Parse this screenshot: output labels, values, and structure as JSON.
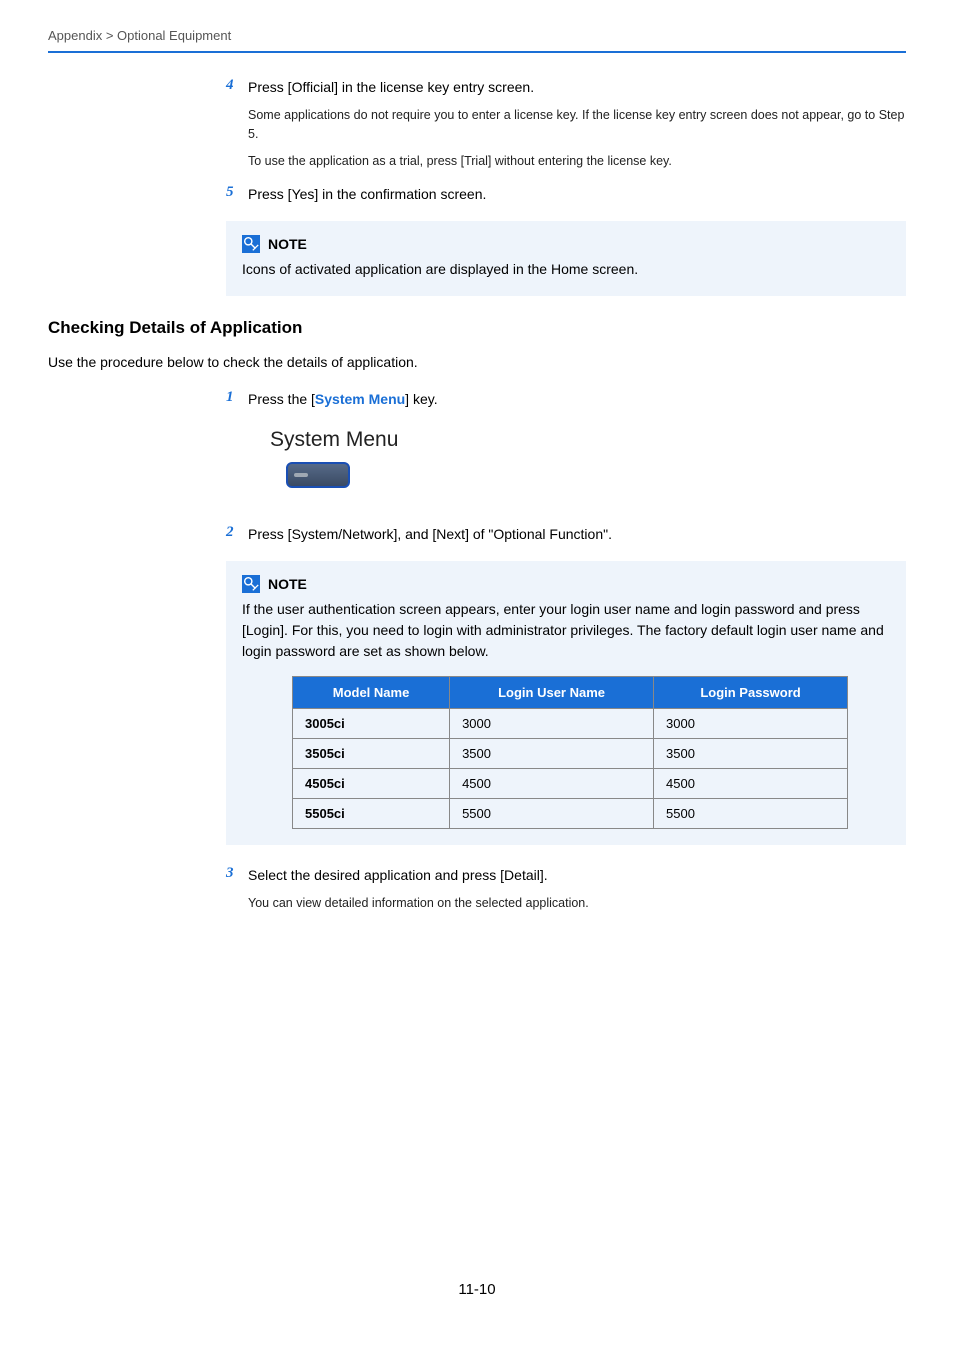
{
  "breadcrumb": "Appendix > Optional Equipment",
  "steps_a": [
    {
      "num": "4",
      "text": "Press [Official] in the license key entry screen.",
      "subs": [
        "Some applications do not require you to enter a license key. If the license key entry screen does not appear, go to Step 5.",
        "To use the application as a trial, press [Trial] without entering the license key."
      ]
    },
    {
      "num": "5",
      "text": "Press [Yes] in the confirmation screen.",
      "subs": []
    }
  ],
  "note1": {
    "title": "NOTE",
    "text": "Icons of activated application are displayed in the Home screen."
  },
  "h2": "Checking Details of Application",
  "intro": "Use the procedure below to check the details of application.",
  "step1": {
    "num": "1",
    "pre": "Press the [",
    "link": "System Menu",
    "post": "] key."
  },
  "sys_menu_label": "System Menu",
  "step2": {
    "num": "2",
    "text": "Press [System/Network], and [Next] of \"Optional Function\"."
  },
  "note2": {
    "title": "NOTE",
    "text": "If the user authentication screen appears, enter your login user name and login password and press [Login]. For this, you need to login with administrator privileges. The factory default login user name and login password are set as shown below."
  },
  "table": {
    "headers": [
      "Model Name",
      "Login User Name",
      "Login Password"
    ],
    "rows": [
      [
        "3005ci",
        "3000",
        "3000"
      ],
      [
        "3505ci",
        "3500",
        "3500"
      ],
      [
        "4505ci",
        "4500",
        "4500"
      ],
      [
        "5505ci",
        "5500",
        "5500"
      ]
    ]
  },
  "step3": {
    "num": "3",
    "text": "Select the desired application and press [Detail].",
    "sub": "You can view detailed information on the selected application."
  },
  "page_number": "11-10"
}
